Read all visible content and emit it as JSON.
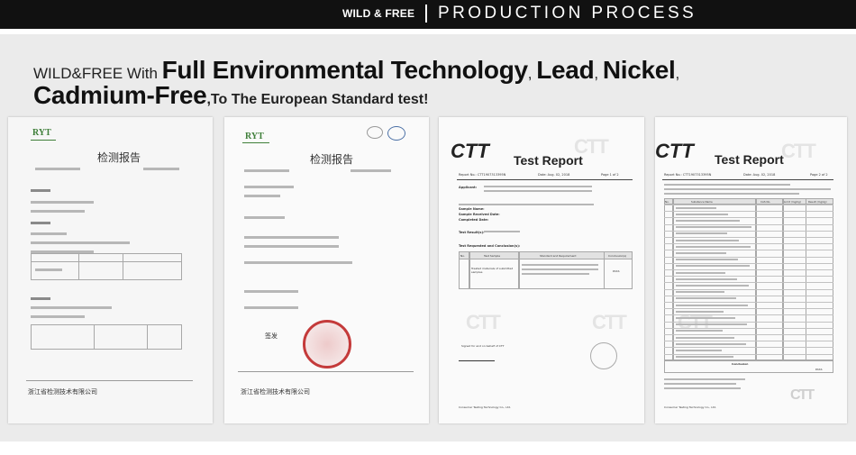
{
  "header": {
    "brand": "WILD & FREE",
    "section_title": "PRODUCTION PROCESS"
  },
  "headline": {
    "prefix": "WILD&FREE With ",
    "part1": "Full Environmental Technology",
    "sep1": ", ",
    "part2": "Lead",
    "sep2": ", ",
    "part3": "Nickel",
    "sep3": ",",
    "part4": "Cadmium-Free",
    "suffix": ",To The European Standard test!"
  },
  "documents": {
    "doc1": {
      "logo": "RYT",
      "title": "检测报告",
      "footer": "浙江省检测技术有限公司"
    },
    "doc2": {
      "logo": "RYT",
      "title": "检测报告",
      "sign": "签发",
      "footer": "浙江省检测技术有限公司"
    },
    "doc3": {
      "logo": "CTT",
      "title": "Test Report",
      "report_no": "Report No.: CTT1907313395N",
      "date": "Date: Aug. 02, 2018",
      "page": "Page 1 of 2",
      "rows": [
        "Applicant:",
        "Sample Name:",
        "Sample Received Date:",
        "Completed Date:"
      ],
      "section1": "Test Result(s):",
      "section2": "Test Requested and Conclusion(s):",
      "col_no": "No.",
      "col_item": "Test Sample",
      "col_std": "Standard and Requirement",
      "col_concl": "Conclusion(s)",
      "row_item": "Treated materials of submitted samples",
      "row_concl": "PASS",
      "signed": "Signed for and on behalf of CTT",
      "company": "Consumer Testing Technology Co., Ltd."
    },
    "doc4": {
      "logo": "CTT",
      "title": "Test Report",
      "report_no": "Report No.: CTT1907313395N",
      "date": "Date: Aug. 02, 2018",
      "page": "Page 2 of 2",
      "col_no": "No.",
      "col_name": "Substance Name",
      "col_cas": "CAS No.",
      "col_limit": "Limit (mg/kg)",
      "col_result": "Result (mg/kg)",
      "conclusion": "Conclusion",
      "pass": "PASS",
      "company": "Consumer Testing Technology Co., Ltd."
    }
  }
}
